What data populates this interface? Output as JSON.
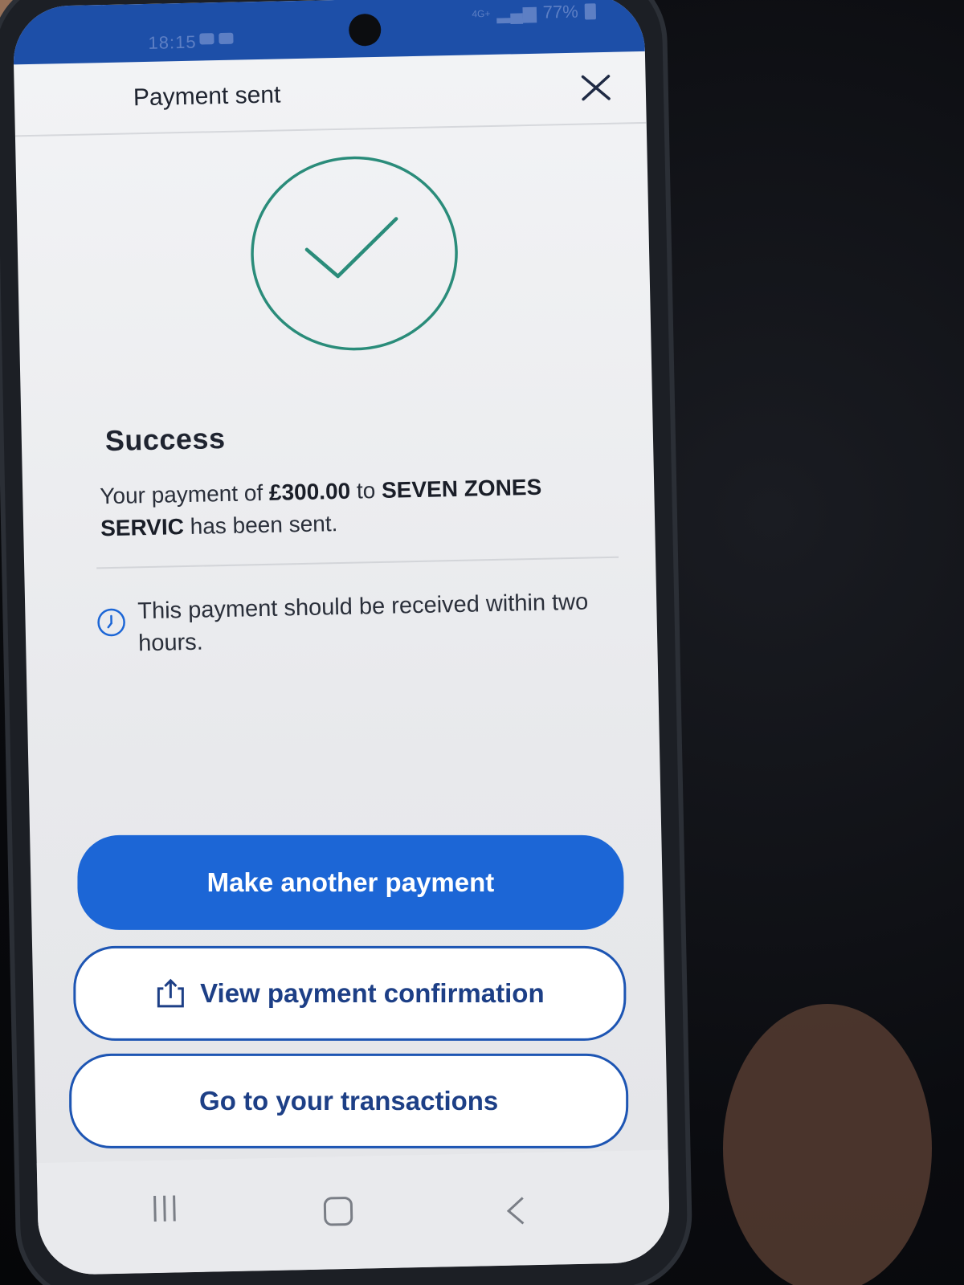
{
  "status": {
    "time": "18:15",
    "battery": "77%",
    "network": "4G+"
  },
  "header": {
    "title": "Payment sent",
    "close_icon": "close-icon"
  },
  "result": {
    "title": "Success",
    "message_prefix": "Your payment of",
    "amount": "£300.00",
    "message_mid": "to",
    "payee": "SEVEN ZONES SERVIC",
    "message_suffix": "has been sent.",
    "info": "This payment should be received within two hours."
  },
  "actions": {
    "primary": "Make another payment",
    "secondary": "View payment confirmation",
    "tertiary": "Go to your transactions"
  },
  "colors": {
    "brand_blue": "#1c66d6",
    "success_green": "#2a8c7a"
  }
}
